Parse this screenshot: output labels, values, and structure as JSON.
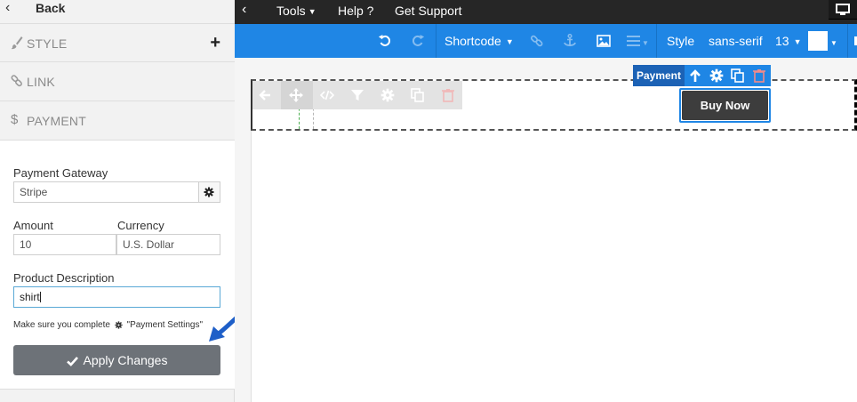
{
  "sidebar": {
    "back_label": "Back",
    "sections": {
      "style": "STYLE",
      "link": "LINK",
      "payment": "PAYMENT"
    },
    "form": {
      "gateway_label": "Payment Gateway",
      "gateway_value": "Stripe",
      "amount_label": "Amount",
      "amount_value": "10",
      "currency_label": "Currency",
      "currency_value": "U.S. Dollar",
      "description_label": "Product Description",
      "description_value": "shirt",
      "note_prefix": "Make sure you complete",
      "note_link": "\"Payment Settings\"",
      "apply_label": "Apply Changes"
    }
  },
  "topbar": {
    "tools": "Tools",
    "help": "Help ?",
    "support": "Get Support"
  },
  "toolbar": {
    "shortcode": "Shortcode",
    "style": "Style",
    "font": "sans-serif",
    "size": "13"
  },
  "canvas": {
    "element_label": "Payment",
    "button_label": "Buy Now"
  },
  "colors": {
    "toolbar_blue": "#1f86e5",
    "label_blue": "#1c62b5",
    "apply_gray": "#6d7278",
    "buy_dark": "#3d3d3d",
    "topbar_dark": "#262626",
    "arrow_blue": "#1e5fc8"
  }
}
